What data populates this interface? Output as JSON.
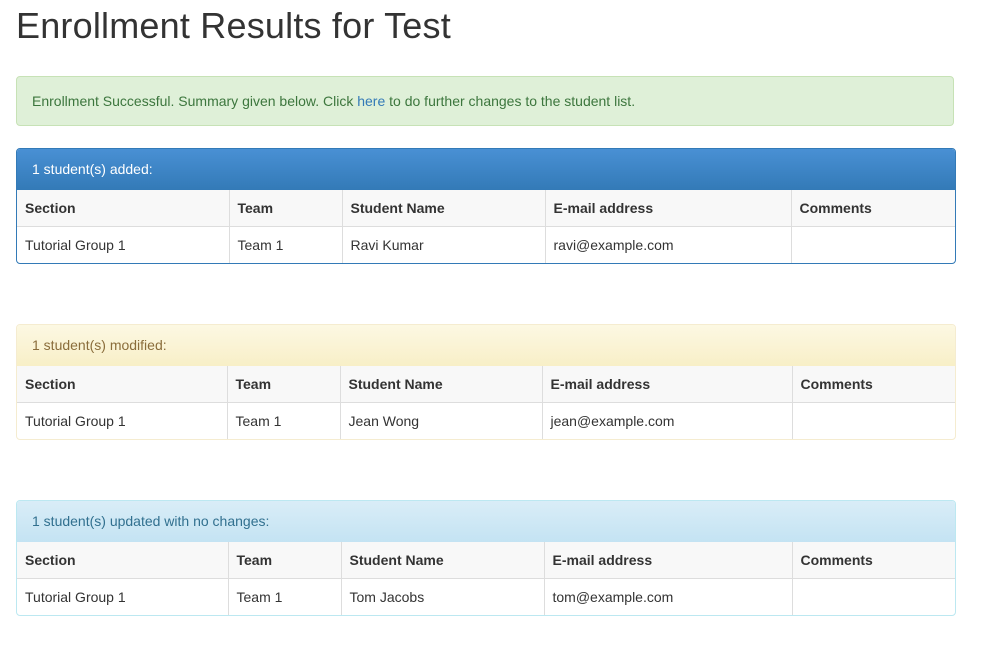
{
  "page": {
    "title": "Enrollment Results for Test"
  },
  "alert": {
    "text_before": "Enrollment Successful. Summary given below. Click ",
    "link_text": "here",
    "text_after": " to do further changes to the student list."
  },
  "columns": [
    "Section",
    "Team",
    "Student Name",
    "E-mail address",
    "Comments"
  ],
  "panels": [
    {
      "heading": "1 student(s) added:",
      "rows": [
        {
          "section": "Tutorial Group 1",
          "team": "Team 1",
          "name": "Ravi Kumar",
          "email": "ravi@example.com",
          "comments": ""
        }
      ]
    },
    {
      "heading": "1 student(s) modified:",
      "rows": [
        {
          "section": "Tutorial Group 1",
          "team": "Team 1",
          "name": "Jean Wong",
          "email": "jean@example.com",
          "comments": ""
        }
      ]
    },
    {
      "heading": "1 student(s) updated with no changes:",
      "rows": [
        {
          "section": "Tutorial Group 1",
          "team": "Team 1",
          "name": "Tom Jacobs",
          "email": "tom@example.com",
          "comments": ""
        }
      ]
    }
  ],
  "colors": {
    "success_bg": "#dff0d8",
    "primary": "#337ab7",
    "warning_bg": "#fcf8e3",
    "info_bg": "#d9edf7"
  }
}
